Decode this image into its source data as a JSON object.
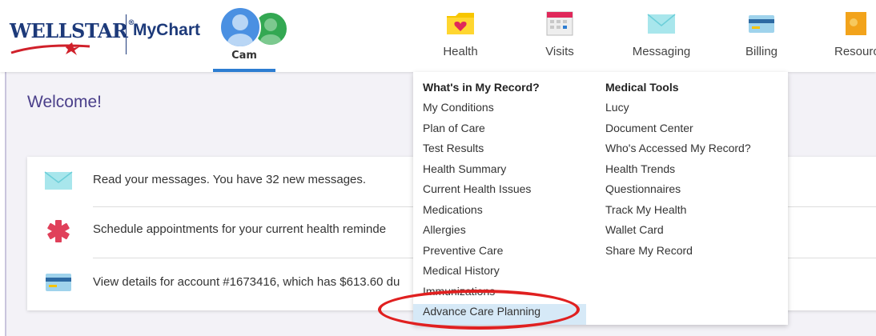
{
  "brand": {
    "name": "WELLSTAR",
    "reg": "®",
    "product": "MyChart"
  },
  "account": {
    "active_user": "Cam"
  },
  "nav": {
    "items": [
      {
        "label": "Health",
        "icon": "folder-heart-icon"
      },
      {
        "label": "Visits",
        "icon": "calendar-icon"
      },
      {
        "label": "Messaging",
        "icon": "envelope-icon"
      },
      {
        "label": "Billing",
        "icon": "credit-card-icon"
      },
      {
        "label": "Resourc",
        "icon": "book-icon"
      }
    ]
  },
  "main": {
    "welcome": "Welcome!",
    "notifications": [
      {
        "text": "Read your messages. You have 32 new messages.",
        "icon": "envelope-icon"
      },
      {
        "text": "Schedule appointments for your current health reminde",
        "icon": "medical-star-icon"
      },
      {
        "text": "View details for account #1673416, which has $613.60 du",
        "icon": "credit-card-icon"
      }
    ]
  },
  "health_menu": {
    "col1_heading": "What's in My Record?",
    "col1_items": [
      "My Conditions",
      "Plan of Care",
      "Test Results",
      "Health Summary",
      "Current Health Issues",
      "Medications",
      "Allergies",
      "Preventive Care",
      "Medical History",
      "Immunizations",
      "Advance Care Planning"
    ],
    "col2_heading": "Medical Tools",
    "col2_items": [
      "Lucy",
      "Document Center",
      "Who's Accessed My Record?",
      "Health Trends",
      "Questionnaires",
      "Track My Health",
      "Wallet Card",
      "Share My Record"
    ],
    "highlighted_item": "Advance Care Planning"
  },
  "colors": {
    "brand_navy": "#1d3a7a",
    "accent_blue": "#2d7dd2",
    "welcome_purple": "#4a3f8a",
    "highlight_bg": "#d6e9f7",
    "annotation_red": "#e02020"
  }
}
